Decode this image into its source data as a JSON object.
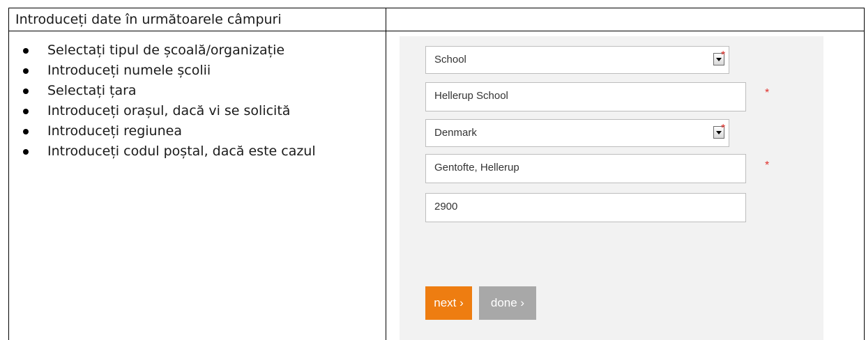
{
  "header": {
    "title": "Introduceți date în următoarele câmpuri"
  },
  "instructions": [
    "Selectați tipul de școală/organizație",
    "Introduceți numele școlii",
    "Selectați țara",
    "Introduceți orașul, dacă vi se solicită",
    "Introduceți regiunea",
    "Introduceți codul poștal, dacă este cazul"
  ],
  "form": {
    "school_type": {
      "value": "School",
      "required_mark": "*"
    },
    "school_name": {
      "value": "Hellerup School",
      "required_mark": "*"
    },
    "country": {
      "value": "Denmark",
      "required_mark": "*"
    },
    "region": {
      "value": "Gentofte, Hellerup",
      "required_mark": "*"
    },
    "postal_code": {
      "value": "2900"
    },
    "next_label": "next ›",
    "done_label": "done ›"
  },
  "colors": {
    "next_button": "#ee7d11",
    "done_button": "#a8a8a8",
    "required_star": "#e0302b",
    "panel_background": "#f2f2f2"
  }
}
